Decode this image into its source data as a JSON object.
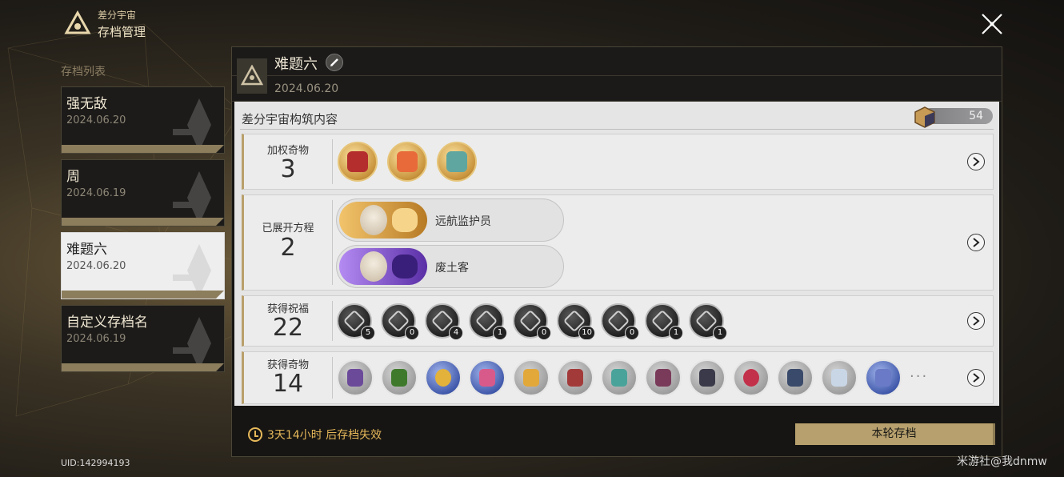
{
  "header": {
    "brand_sub": "差分宇宙",
    "brand_title": "存档管理"
  },
  "sidebar": {
    "list_title": "存档列表",
    "saves": [
      {
        "name": "强无敌",
        "date": "2024.06.20",
        "active": false
      },
      {
        "name": "周",
        "date": "2024.06.19",
        "active": false
      },
      {
        "name": "难题六",
        "date": "2024.06.20",
        "active": true
      },
      {
        "name": "自定义存档名",
        "date": "2024.06.19",
        "active": false
      }
    ],
    "uid": "UID:142994193"
  },
  "panel": {
    "title": "难题六",
    "date": "2024.06.20",
    "content_title": "差分宇宙构筑内容",
    "counter": "54",
    "rows": {
      "weighted": {
        "label": "加权奇物",
        "count": "3"
      },
      "equations": {
        "label": "已展开方程",
        "count": "2",
        "items": [
          {
            "name": "远航监护员",
            "color": "#e0a53a"
          },
          {
            "name": "废土客",
            "color": "#7a4bd1"
          }
        ]
      },
      "blessings": {
        "label": "获得祝福",
        "count": "22",
        "badges": [
          "5",
          "0",
          "4",
          "1",
          "0",
          "10",
          "0",
          "1",
          "1"
        ]
      },
      "curios": {
        "label": "获得奇物",
        "count": "14",
        "more": "···"
      }
    },
    "timer": "3天14小时 后存档失效",
    "save_button": "本轮存档"
  },
  "watermark": "米游社@我dnmw",
  "colors": {
    "gold": "#b7a06d",
    "timer": "#e6b85a",
    "active_card": "#eeeeef"
  }
}
